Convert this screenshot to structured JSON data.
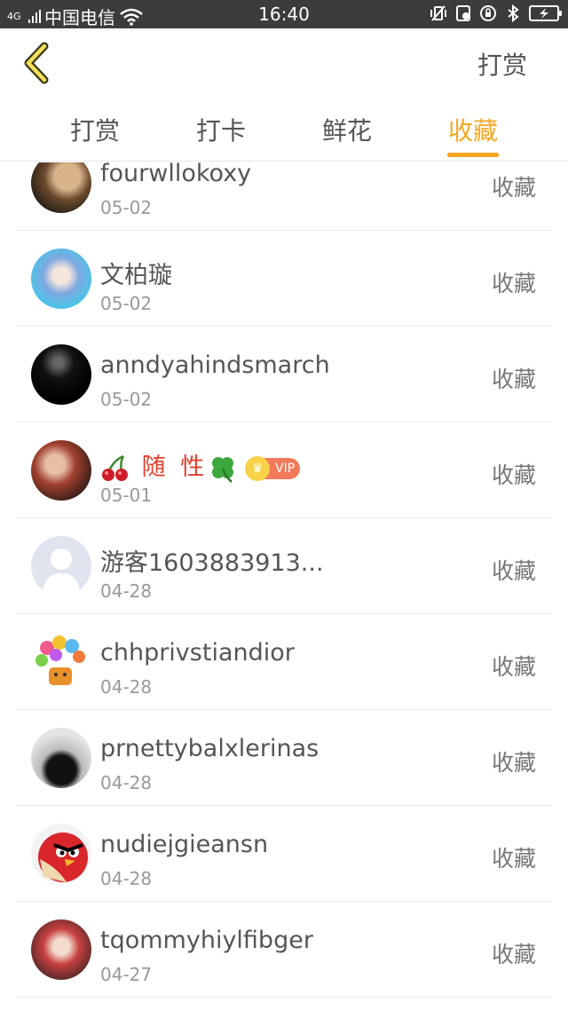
{
  "status_bar": {
    "network": "4G",
    "carrier": "中国电信",
    "time": "16:40"
  },
  "header": {
    "action_label": "打赏"
  },
  "tabs": [
    {
      "label": "打赏",
      "active": false
    },
    {
      "label": "打卡",
      "active": false
    },
    {
      "label": "鲜花",
      "active": false
    },
    {
      "label": "收藏",
      "active": true
    }
  ],
  "colors": {
    "accent": "#f5a623",
    "status_bar": "#3c3c3c",
    "vip_name": "#e0412f"
  },
  "list": [
    {
      "name": "fourwllokoxy",
      "date": "05-02",
      "action": "收藏"
    },
    {
      "name": "文柏璇",
      "date": "05-02",
      "action": "收藏"
    },
    {
      "name": "anndyahindsmarch",
      "date": "05-02",
      "action": "收藏"
    },
    {
      "name": "随 性",
      "date": "05-01",
      "action": "收藏",
      "vip": "VIP"
    },
    {
      "name": "游客1603883913...",
      "date": "04-28",
      "action": "收藏"
    },
    {
      "name": "chhprivstiandior",
      "date": "04-28",
      "action": "收藏"
    },
    {
      "name": "prnettybalxlerinas",
      "date": "04-28",
      "action": "收藏"
    },
    {
      "name": "nudiejgieansn",
      "date": "04-28",
      "action": "收藏"
    },
    {
      "name": "tqommyhiylfibger",
      "date": "04-27",
      "action": "收藏"
    }
  ]
}
